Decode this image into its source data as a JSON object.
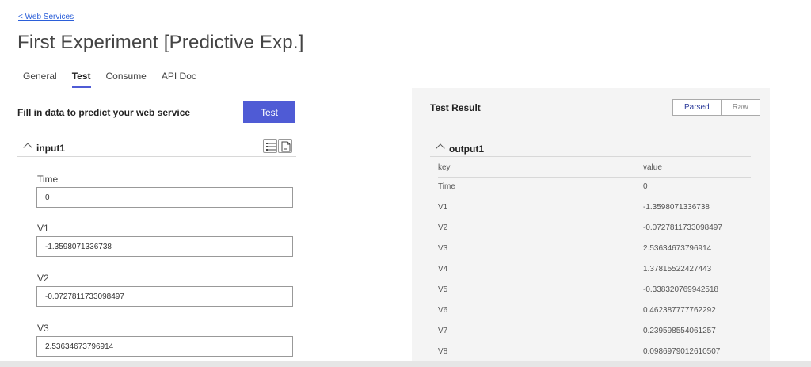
{
  "nav": {
    "back_label": "< Web Services"
  },
  "page": {
    "title": "First Experiment [Predictive Exp.]"
  },
  "tabs": [
    {
      "label": "General"
    },
    {
      "label": "Test"
    },
    {
      "label": "Consume"
    },
    {
      "label": "API Doc"
    }
  ],
  "active_tab": "Test",
  "input_panel": {
    "heading": "Fill in data to predict your web service",
    "test_button": "Test",
    "section": "input1",
    "fields": [
      {
        "label": "Time",
        "value": "0"
      },
      {
        "label": "V1",
        "value": "-1.3598071336738"
      },
      {
        "label": "V2",
        "value": "-0.0727811733098497"
      },
      {
        "label": "V3",
        "value": "2.53634673796914"
      }
    ]
  },
  "result_panel": {
    "heading": "Test Result",
    "toggle": {
      "parsed": "Parsed",
      "raw": "Raw",
      "selected": "Parsed"
    },
    "section": "output1",
    "columns": {
      "key": "key",
      "value": "value"
    },
    "rows": [
      {
        "key": "Time",
        "value": "0"
      },
      {
        "key": "V1",
        "value": "-1.3598071336738"
      },
      {
        "key": "V2",
        "value": "-0.0727811733098497"
      },
      {
        "key": "V3",
        "value": "2.53634673796914"
      },
      {
        "key": "V4",
        "value": "1.37815522427443"
      },
      {
        "key": "V5",
        "value": "-0.338320769942518"
      },
      {
        "key": "V6",
        "value": "0.462387777762292"
      },
      {
        "key": "V7",
        "value": "0.239598554061257"
      },
      {
        "key": "V8",
        "value": "0.0986979012610507"
      }
    ]
  },
  "colors": {
    "accent": "#4f5bd5",
    "link": "#2b5fd9",
    "panel_bg": "#f4f4f4"
  }
}
